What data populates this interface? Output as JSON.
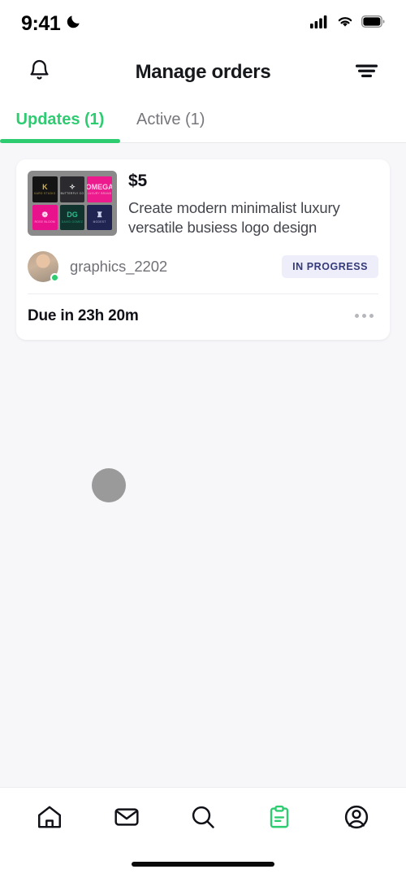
{
  "status_bar": {
    "time": "9:41",
    "dnd_icon": "crescent-moon-icon",
    "cellular_icon": "cellular-signal-icon",
    "wifi_icon": "wifi-icon",
    "battery_icon": "battery-full-icon"
  },
  "header": {
    "title": "Manage orders",
    "left_icon": "bell-icon",
    "right_icon": "filter-icon"
  },
  "tabs": [
    {
      "label": "Updates (1)",
      "active": true
    },
    {
      "label": "Active (1)",
      "active": false
    }
  ],
  "order": {
    "price": "$5",
    "title": "Create modern minimalist luxury versatile busiess logo design",
    "seller": "graphics_2202",
    "seller_online": true,
    "status_badge": "IN PROGRESS",
    "due": "Due in 23h 20m",
    "overflow_icon": "more-horizontal-icon",
    "thumbnail": {
      "background": "#8a8a8a",
      "cells": [
        {
          "name": "K",
          "sub": "KARO STUDIO",
          "bg": "#141414",
          "fg": "#d6b24a"
        },
        {
          "name": "✧",
          "sub": "BUTTERFLY CO",
          "bg": "#2b2b2f",
          "fg": "#f2f2f2"
        },
        {
          "name": "OMEGA",
          "sub": "LUXURY BRAND",
          "bg": "#ec1a8c",
          "fg": "#f7d7e8"
        },
        {
          "name": "❁",
          "sub": "ROSE BLOOM",
          "bg": "#e8128c",
          "fg": "#ffd7ec"
        },
        {
          "name": "DG",
          "sub": "DAVID GOMEZ",
          "bg": "#11332e",
          "fg": "#27c08a"
        },
        {
          "name": "♜",
          "sub": "MODEST",
          "bg": "#202450",
          "fg": "#cfd4f2"
        }
      ]
    }
  },
  "bottom_nav": [
    {
      "icon": "home-icon",
      "active": false
    },
    {
      "icon": "mail-icon",
      "active": false
    },
    {
      "icon": "search-icon",
      "active": false
    },
    {
      "icon": "clipboard-icon",
      "active": true
    },
    {
      "icon": "profile-icon",
      "active": false
    }
  ],
  "colors": {
    "accent_green": "#2ecc71",
    "badge_bg": "#eeeefb",
    "badge_text": "#343a7a",
    "page_bg": "#f7f6f9"
  }
}
